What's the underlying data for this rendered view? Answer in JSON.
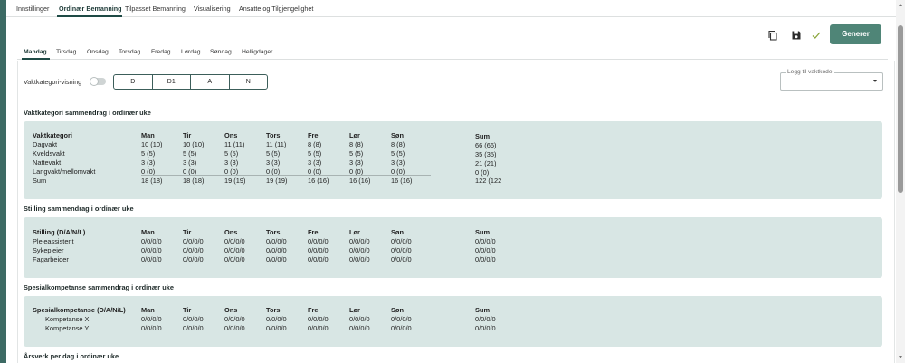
{
  "top_tabs": [
    {
      "label": "Innstillinger",
      "active": false
    },
    {
      "label": "Ordinær Bemanning",
      "active": true
    },
    {
      "label": "Tilpasset Bemanning",
      "active": false
    },
    {
      "label": "Visualisering",
      "active": false
    },
    {
      "label": "Ansatte og Tilgjengelighet",
      "active": false
    }
  ],
  "toolbar": {
    "copy_icon": "copy-icon",
    "save_icon": "save-icon",
    "check_icon": "checkmark-icon",
    "generate_label": "Generer"
  },
  "day_tabs": [
    {
      "label": "Mandag",
      "active": true
    },
    {
      "label": "Tirsdag",
      "active": false
    },
    {
      "label": "Onsdag",
      "active": false
    },
    {
      "label": "Torsdag",
      "active": false
    },
    {
      "label": "Fredag",
      "active": false
    },
    {
      "label": "Lørdag",
      "active": false
    },
    {
      "label": "Søndag",
      "active": false
    },
    {
      "label": "Helligdager",
      "active": false
    }
  ],
  "filters": {
    "vaktkategori_label": "Vaktkategori-visning",
    "toggle_on": false,
    "segments": [
      "D",
      "D1",
      "A",
      "N"
    ],
    "add_shift_label": "Legg til vaktkode"
  },
  "sections": {
    "vaktkategori": {
      "title": "Vaktkategori sammendrag i ordinær uke",
      "headers": [
        "Vaktkategori",
        "Man",
        "Tir",
        "Ons",
        "Tors",
        "Fre",
        "Lør",
        "Søn",
        "Sum"
      ],
      "rows": [
        [
          "Dagvakt",
          "10 (10)",
          "10 (10)",
          "11 (11)",
          "11 (11)",
          "8 (8)",
          "8 (8)",
          "8 (8)",
          "66 (66)"
        ],
        [
          "Kveldsvakt",
          "5 (5)",
          "5 (5)",
          "5 (5)",
          "5 (5)",
          "5 (5)",
          "5 (5)",
          "5 (5)",
          "35 (35)"
        ],
        [
          "Nattevakt",
          "3 (3)",
          "3 (3)",
          "3 (3)",
          "3 (3)",
          "3 (3)",
          "3 (3)",
          "3 (3)",
          "21 (21)"
        ],
        [
          "Langvakt/mellomvakt",
          "0 (0)",
          "0 (0)",
          "0 (0)",
          "0 (0)",
          "0 (0)",
          "0 (0)",
          "0 (0)",
          "0 (0)"
        ],
        [
          "Sum",
          "18 (18)",
          "18 (18)",
          "19 (19)",
          "19 (19)",
          "16 (16)",
          "16 (16)",
          "16 (16)",
          "122 (122"
        ]
      ]
    },
    "stilling": {
      "title": "Stilling sammendrag i ordinær uke",
      "headers": [
        "Stilling (D/A/N/L)",
        "Man",
        "Tir",
        "Ons",
        "Tors",
        "Fre",
        "Lør",
        "Søn",
        "Sum"
      ],
      "rows": [
        [
          "Pleieassistent",
          "0/0/0/0",
          "0/0/0/0",
          "0/0/0/0",
          "0/0/0/0",
          "0/0/0/0",
          "0/0/0/0",
          "0/0/0/0",
          "0/0/0/0"
        ],
        [
          "Sykepleier",
          "0/0/0/0",
          "0/0/0/0",
          "0/0/0/0",
          "0/0/0/0",
          "0/0/0/0",
          "0/0/0/0",
          "0/0/0/0",
          "0/0/0/0"
        ],
        [
          "Fagarbeider",
          "0/0/0/0",
          "0/0/0/0",
          "0/0/0/0",
          "0/0/0/0",
          "0/0/0/0",
          "0/0/0/0",
          "0/0/0/0",
          "0/0/0/0"
        ]
      ]
    },
    "spesial": {
      "title": "Spesialkompetanse sammendrag i ordinær uke",
      "headers": [
        "Spesialkompetanse (D/A/N/L)",
        "Man",
        "Tir",
        "Ons",
        "Tors",
        "Fre",
        "Lør",
        "Søn",
        "Sum"
      ],
      "rows": [
        [
          "Kompetanse X",
          "0/0/0/0",
          "0/0/0/0",
          "0/0/0/0",
          "0/0/0/0",
          "0/0/0/0",
          "0/0/0/0",
          "0/0/0/0",
          "0/0/0/0"
        ],
        [
          "Kompetanse Y",
          "0/0/0/0",
          "0/0/0/0",
          "0/0/0/0",
          "0/0/0/0",
          "0/0/0/0",
          "0/0/0/0",
          "0/0/0/0",
          "0/0/0/0"
        ]
      ]
    },
    "arsverk": {
      "title": "Årsverk per dag i ordinær uke"
    }
  },
  "colors": {
    "accent": "#4f8577",
    "panel_bg": "#d8e6e4",
    "sidebar": "#3c6a64"
  }
}
